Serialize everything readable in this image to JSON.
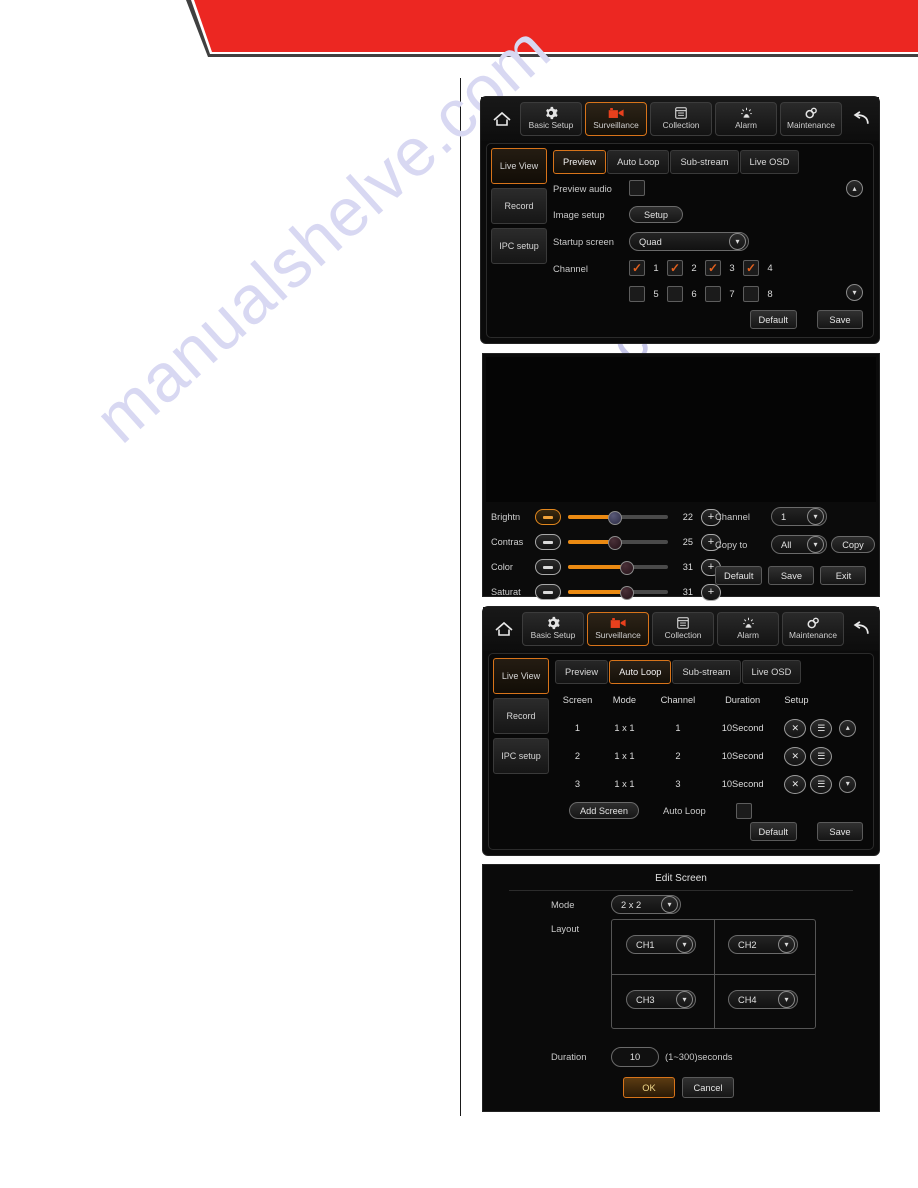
{
  "page": {
    "banner_color": "#ec2722",
    "accent_color": "#d8741a",
    "watermark": "manualshelve.com",
    "watermark_tail": "e.com"
  },
  "toolbar": {
    "home_icon": "home-icon",
    "back_icon": "back-arrow-icon",
    "items": [
      {
        "label": "Basic Setup",
        "icon": "gear-icon",
        "active": false
      },
      {
        "label": "Surveillance",
        "icon": "camcorder-icon",
        "active": true
      },
      {
        "label": "Collection",
        "icon": "window-icon",
        "active": false
      },
      {
        "label": "Alarm",
        "icon": "siren-icon",
        "active": false
      },
      {
        "label": "Maintenance",
        "icon": "dual-gear-icon",
        "active": false
      }
    ]
  },
  "side_menu": {
    "items": [
      {
        "label": "Live View",
        "active": true
      },
      {
        "label": "Record",
        "active": false
      },
      {
        "label": "IPC setup",
        "active": false
      }
    ]
  },
  "tabs": {
    "items": [
      "Preview",
      "Auto Loop",
      "Sub-stream",
      "Live OSD"
    ]
  },
  "preview_panel": {
    "active_tab": "Preview",
    "preview_audio_label": "Preview audio",
    "preview_audio_checked": false,
    "image_setup_label": "Image setup",
    "image_setup_button": "Setup",
    "startup_screen_label": "Startup screen",
    "startup_screen_value": "Quad",
    "channel_label": "Channel",
    "channels": [
      {
        "num": "1",
        "checked": true
      },
      {
        "num": "2",
        "checked": true
      },
      {
        "num": "3",
        "checked": true
      },
      {
        "num": "4",
        "checked": true
      },
      {
        "num": "5",
        "checked": false
      },
      {
        "num": "6",
        "checked": false
      },
      {
        "num": "7",
        "checked": false
      },
      {
        "num": "8",
        "checked": false
      }
    ],
    "default_button": "Default",
    "save_button": "Save",
    "scroll_up_icon": "chevron-up-icon",
    "scroll_down_icon": "chevron-down-icon"
  },
  "image_panel": {
    "sliders": [
      {
        "label": "Brightn",
        "value": "22",
        "percent": 46,
        "focused": true
      },
      {
        "label": "Contras",
        "value": "25",
        "percent": 46,
        "focused": false
      },
      {
        "label": "Color",
        "value": "31",
        "percent": 58,
        "focused": false
      },
      {
        "label": "Saturat",
        "value": "31",
        "percent": 58,
        "focused": false
      }
    ],
    "channel_label": "Channel",
    "channel_value": "1",
    "copy_to_label": "Copy to",
    "copy_to_value": "All",
    "copy_button": "Copy",
    "default_button": "Default",
    "save_button": "Save",
    "exit_button": "Exit",
    "minus_icon": "minus-icon",
    "plus_icon": "plus-icon"
  },
  "autoloop_panel": {
    "active_tab": "Auto Loop",
    "columns": [
      "Screen",
      "Mode",
      "Channel",
      "Duration",
      "Setup"
    ],
    "rows": [
      {
        "screen": "1",
        "mode": "1 x 1",
        "channel": "1",
        "duration": "10Second"
      },
      {
        "screen": "2",
        "mode": "1 x 1",
        "channel": "2",
        "duration": "10Second"
      },
      {
        "screen": "3",
        "mode": "1 x 1",
        "channel": "3",
        "duration": "10Second"
      }
    ],
    "delete_icon": "close-x-icon",
    "edit_icon": "list-edit-icon",
    "add_screen_button": "Add Screen",
    "auto_loop_label": "Auto Loop",
    "auto_loop_checked": false,
    "default_button": "Default",
    "save_button": "Save",
    "scroll_up_icon": "chevron-up-icon",
    "scroll_down_icon": "chevron-down-icon"
  },
  "edit_screen_dialog": {
    "title": "Edit Screen",
    "mode_label": "Mode",
    "mode_value": "2 x 2",
    "layout_label": "Layout",
    "layout_cells": [
      "CH1",
      "CH2",
      "CH3",
      "CH4"
    ],
    "duration_label": "Duration",
    "duration_value": "10",
    "duration_hint": "(1~300)seconds",
    "ok_button": "OK",
    "cancel_button": "Cancel"
  }
}
